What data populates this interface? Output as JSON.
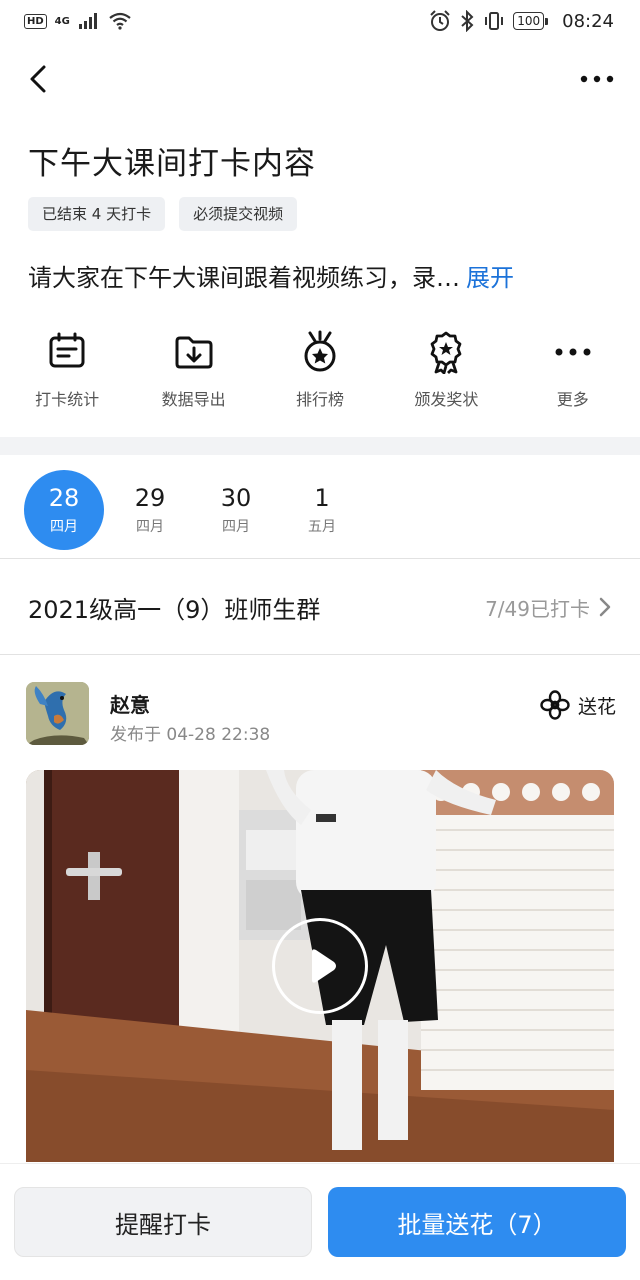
{
  "status_bar": {
    "time": "08:24",
    "battery": "100",
    "network": "4G",
    "hd": "HD"
  },
  "page": {
    "title": "下午大课间打卡内容",
    "tags": [
      "已结束 4 天打卡",
      "必须提交视频"
    ],
    "description": "请大家在下午大课间跟着视频练习，录…",
    "expand_label": "展开"
  },
  "actions": [
    {
      "label": "打卡统计",
      "icon": "calendar-card-icon"
    },
    {
      "label": "数据导出",
      "icon": "folder-download-icon"
    },
    {
      "label": "排行榜",
      "icon": "medal-star-icon"
    },
    {
      "label": "颁发奖状",
      "icon": "award-ribbon-icon"
    },
    {
      "label": "更多",
      "icon": "more-dots-icon"
    }
  ],
  "dates": [
    {
      "day": "28",
      "month": "四月",
      "active": true
    },
    {
      "day": "29",
      "month": "四月",
      "active": false
    },
    {
      "day": "30",
      "month": "四月",
      "active": false
    },
    {
      "day": "1",
      "month": "五月",
      "active": false
    }
  ],
  "group": {
    "name": "2021级高一（9）班师生群",
    "count": "7/49已打卡"
  },
  "post": {
    "user": "赵意",
    "time": "发布于 04-28 22:38",
    "flower_label": "送花"
  },
  "bottom": {
    "remind_label": "提醒打卡",
    "flowers_label": "批量送花（7）"
  },
  "colors": {
    "accent": "#2e8cf0",
    "link": "#1b72d9"
  }
}
